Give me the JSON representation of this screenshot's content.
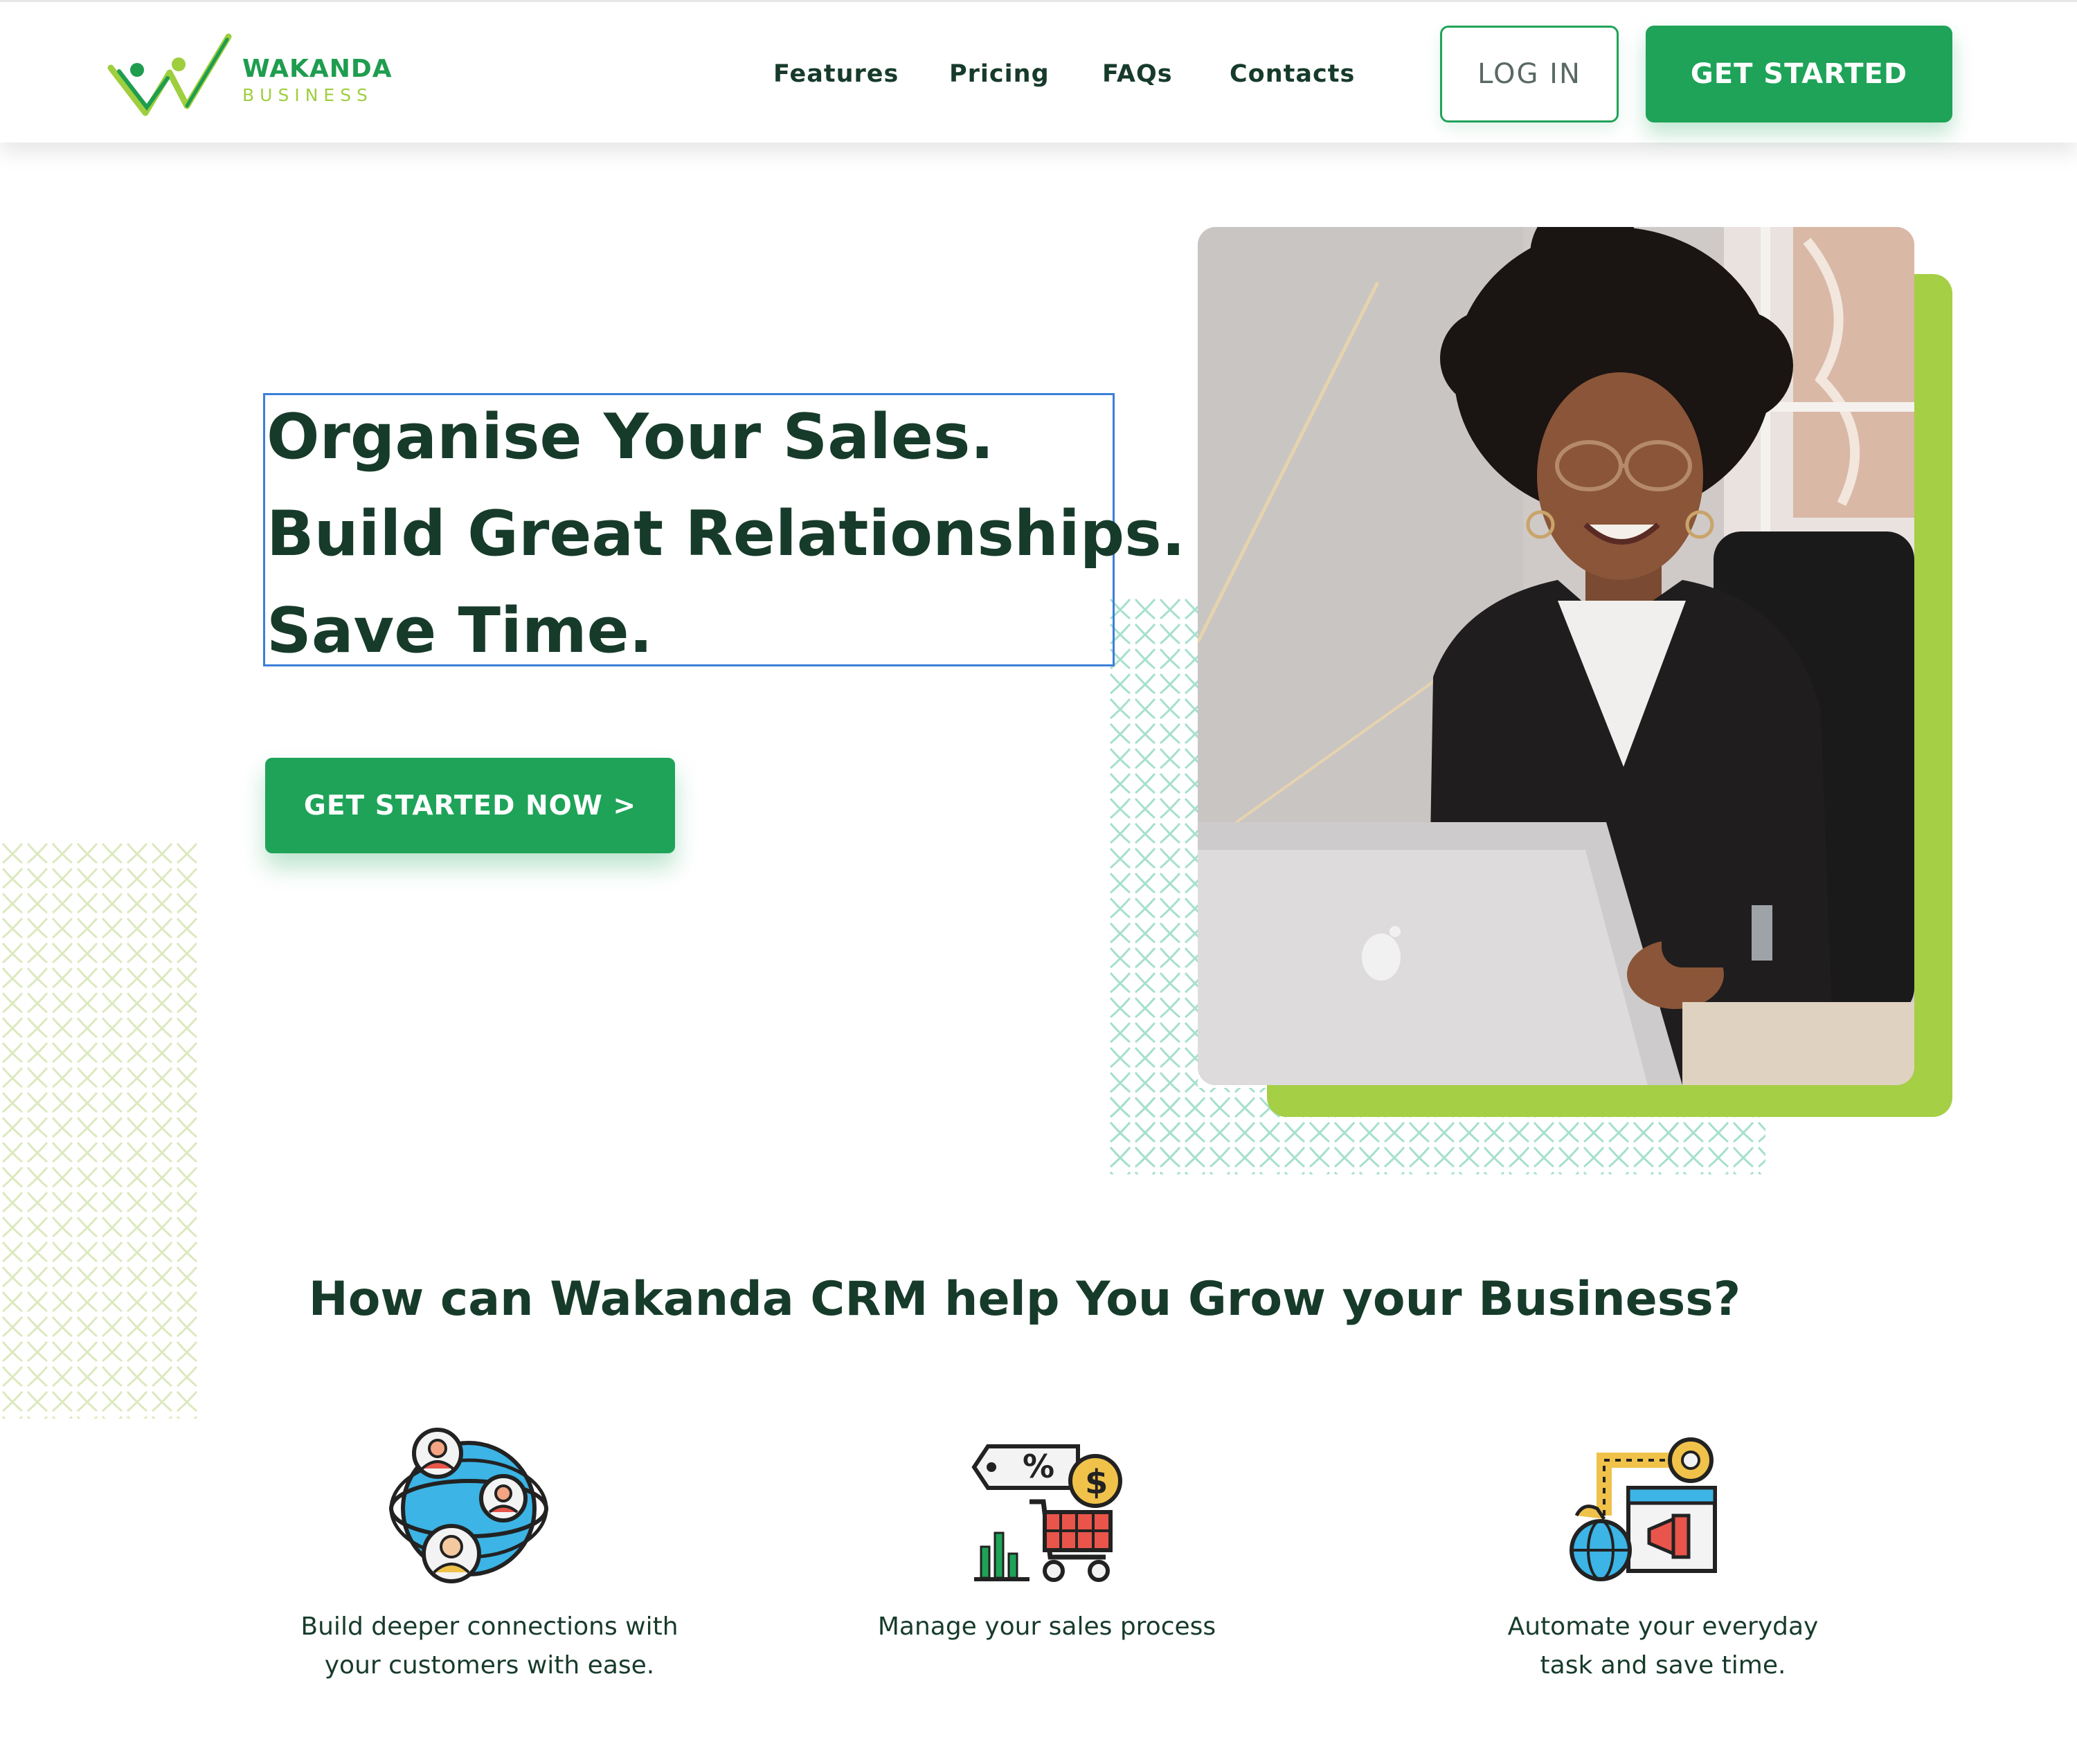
{
  "brand": {
    "name_line1": "WAKANDA",
    "name_line2": "BUSINESS"
  },
  "nav": {
    "links": [
      "Features",
      "Pricing",
      "FAQs",
      "Contacts"
    ],
    "login_label": "LOG IN",
    "cta_label": "GET STARTED"
  },
  "hero": {
    "lines": [
      "Organise Your Sales.",
      "Build Great Relationships.",
      "Save Time."
    ],
    "cta_label": "GET STARTED NOW >"
  },
  "section": {
    "title": "How can Wakanda CRM help You Grow your Business?",
    "features": [
      {
        "icon": "global-customers-icon",
        "line1": "Build deeper connections with",
        "line2": "your customers with ease."
      },
      {
        "icon": "sales-cart-icon",
        "line1": "Manage your sales process",
        "line2": ""
      },
      {
        "icon": "automation-gear-icon",
        "line1": "Automate your everyday",
        "line2": "task and save time."
      }
    ]
  },
  "colors": {
    "primary_green": "#1ea358",
    "lime_green": "#a5cf45",
    "heading_dark": "#173b2b",
    "selection_outline": "#3b7fd9"
  }
}
